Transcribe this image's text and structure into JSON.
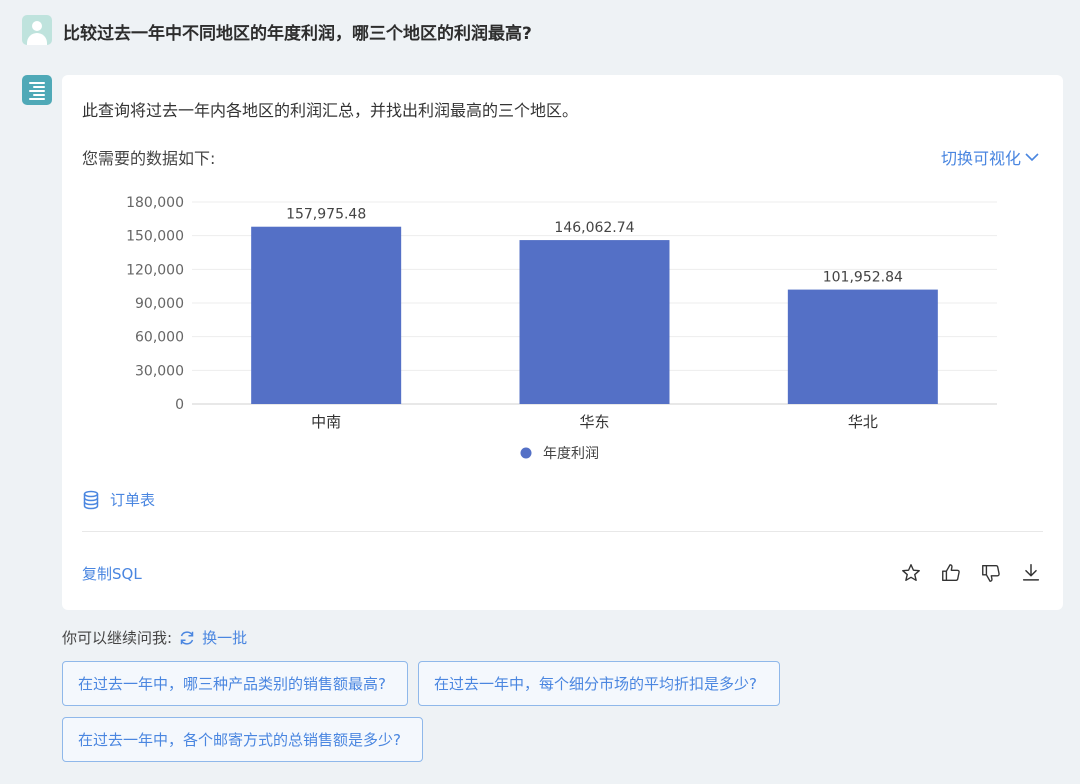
{
  "question": "比较过去一年中不同地区的年度利润，哪三个地区的利润最高?",
  "answer": {
    "intro": "此查询将过去一年内各地区的利润汇总，并找出利润最高的三个地区。",
    "data_label": "您需要的数据如下:",
    "toggle_label": "切换可视化",
    "source_label": "订单表",
    "copy_sql_label": "复制SQL"
  },
  "chart_data": {
    "type": "bar",
    "categories": [
      "中南",
      "华东",
      "华北"
    ],
    "series": [
      {
        "name": "年度利润",
        "values": [
          157975.48,
          146062.74,
          101952.84
        ],
        "color": "#5470c6"
      }
    ],
    "data_labels": [
      "157,975.48",
      "146,062.74",
      "101,952.84"
    ],
    "y_ticks": [
      "0",
      "30,000",
      "60,000",
      "90,000",
      "120,000",
      "150,000",
      "180,000"
    ],
    "ylim": [
      0,
      180000
    ],
    "grid": true,
    "legend_position": "bottom-center"
  },
  "followup": {
    "label": "你可以继续问我:",
    "refresh_label": "换一批",
    "suggestions": [
      "在过去一年中，哪三种产品类别的销售额最高?",
      "在过去一年中，每个细分市场的平均折扣是多少?",
      "在过去一年中，各个邮寄方式的总销售额是多少?"
    ]
  },
  "colors": {
    "accent": "#4a86e0",
    "bar": "#5470c6",
    "bot_avatar": "#4fa9b7",
    "user_avatar": "#bfe3dd"
  }
}
